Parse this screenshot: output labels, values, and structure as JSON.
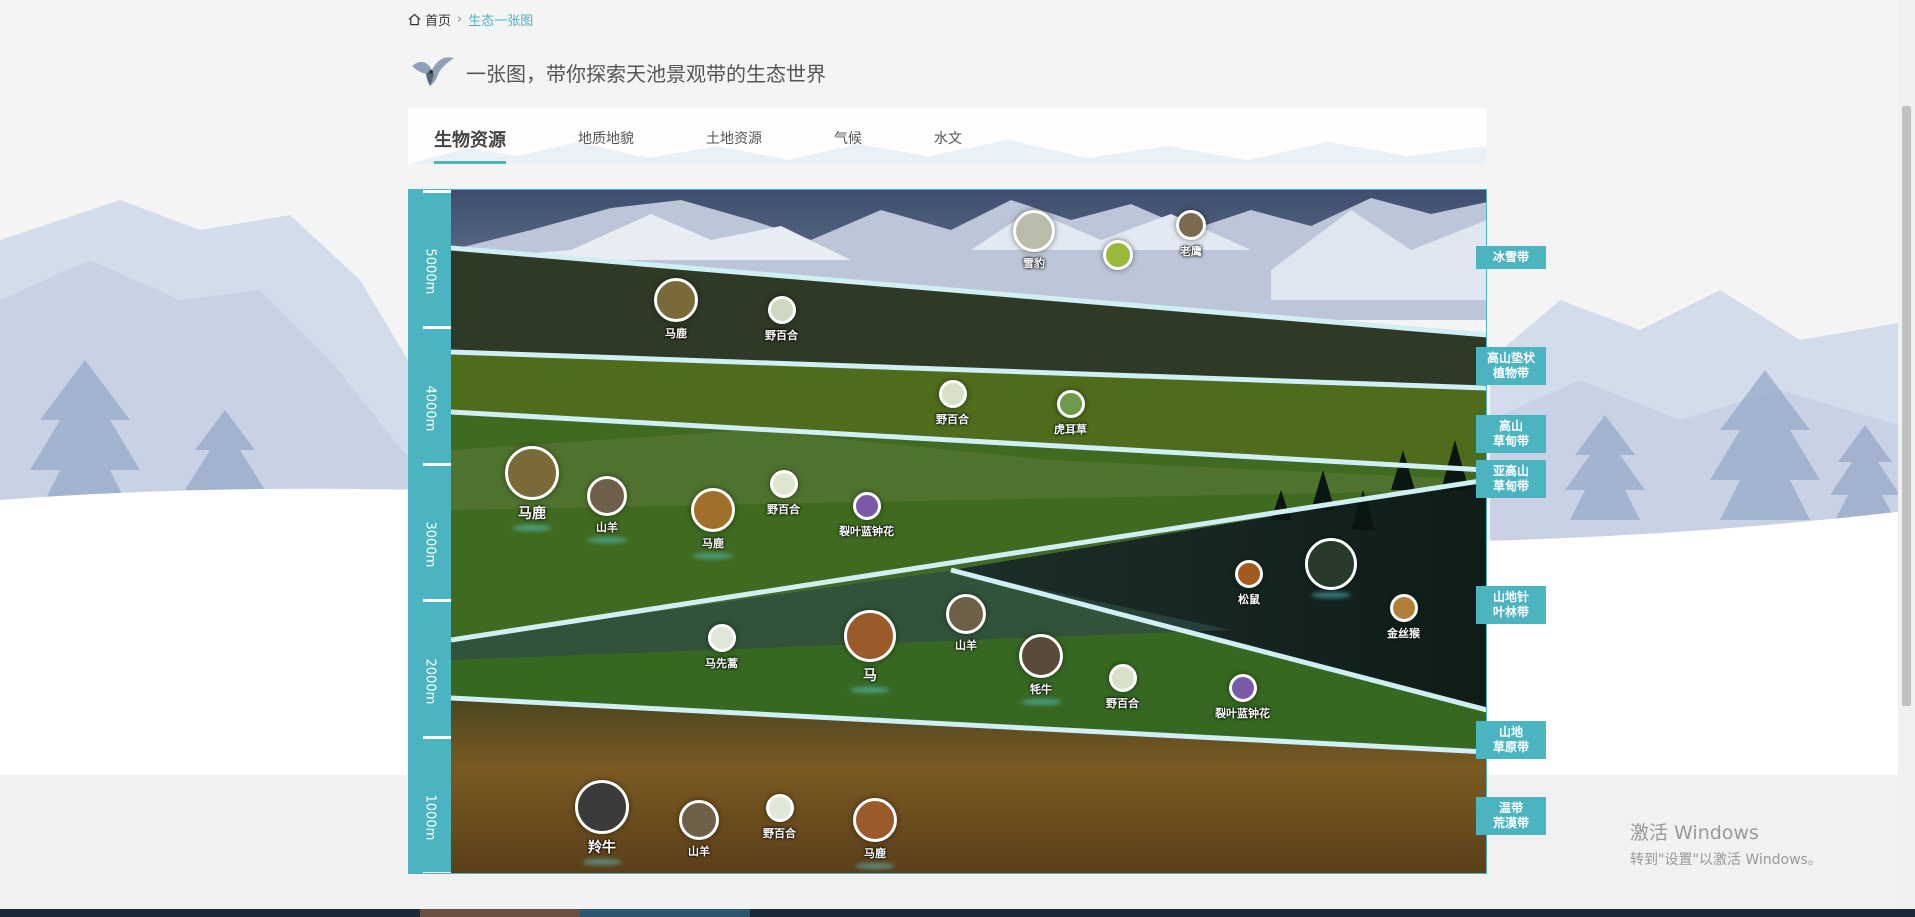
{
  "breadcrumb": {
    "home": "首页",
    "current": "生态一张图"
  },
  "page_title": "一张图，带你探索天池景观带的生态世界",
  "tabs": [
    {
      "label": "生物资源",
      "active": true
    },
    {
      "label": "地质地貌"
    },
    {
      "label": "土地资源"
    },
    {
      "label": "气候"
    },
    {
      "label": "水文"
    }
  ],
  "altitudes": [
    "5000m",
    "4000m",
    "3000m",
    "2000m",
    "1000m"
  ],
  "zones": [
    "冰雪带",
    "高山垫状植物带",
    "高山草甸带",
    "亚高山草甸带",
    "山地针叶林带",
    "山地草原带",
    "温带荒漠带"
  ],
  "species": [
    {
      "name": "雪豹"
    },
    {
      "name": ""
    },
    {
      "name": "老鹰"
    },
    {
      "name": "马鹿"
    },
    {
      "name": "野百合"
    },
    {
      "name": "野百合"
    },
    {
      "name": "虎耳草"
    },
    {
      "name": "马鹿"
    },
    {
      "name": "山羊"
    },
    {
      "name": "马鹿"
    },
    {
      "name": "野百合"
    },
    {
      "name": "裂叶蓝钟花"
    },
    {
      "name": "松鼠"
    },
    {
      "name": ""
    },
    {
      "name": "金丝猴"
    },
    {
      "name": "马先蒿"
    },
    {
      "name": "马"
    },
    {
      "name": "山羊"
    },
    {
      "name": "牦牛"
    },
    {
      "name": "野百合"
    },
    {
      "name": "裂叶蓝钟花"
    },
    {
      "name": "羚牛"
    },
    {
      "name": "山羊"
    },
    {
      "name": "野百合"
    },
    {
      "name": "马鹿"
    }
  ],
  "windows_activation": {
    "line1": "激活 Windows",
    "line2": "转到\"设置\"以激活 Windows。"
  },
  "colors": {
    "accent": "#4bb4c0",
    "band_line": "#cfeff5"
  }
}
